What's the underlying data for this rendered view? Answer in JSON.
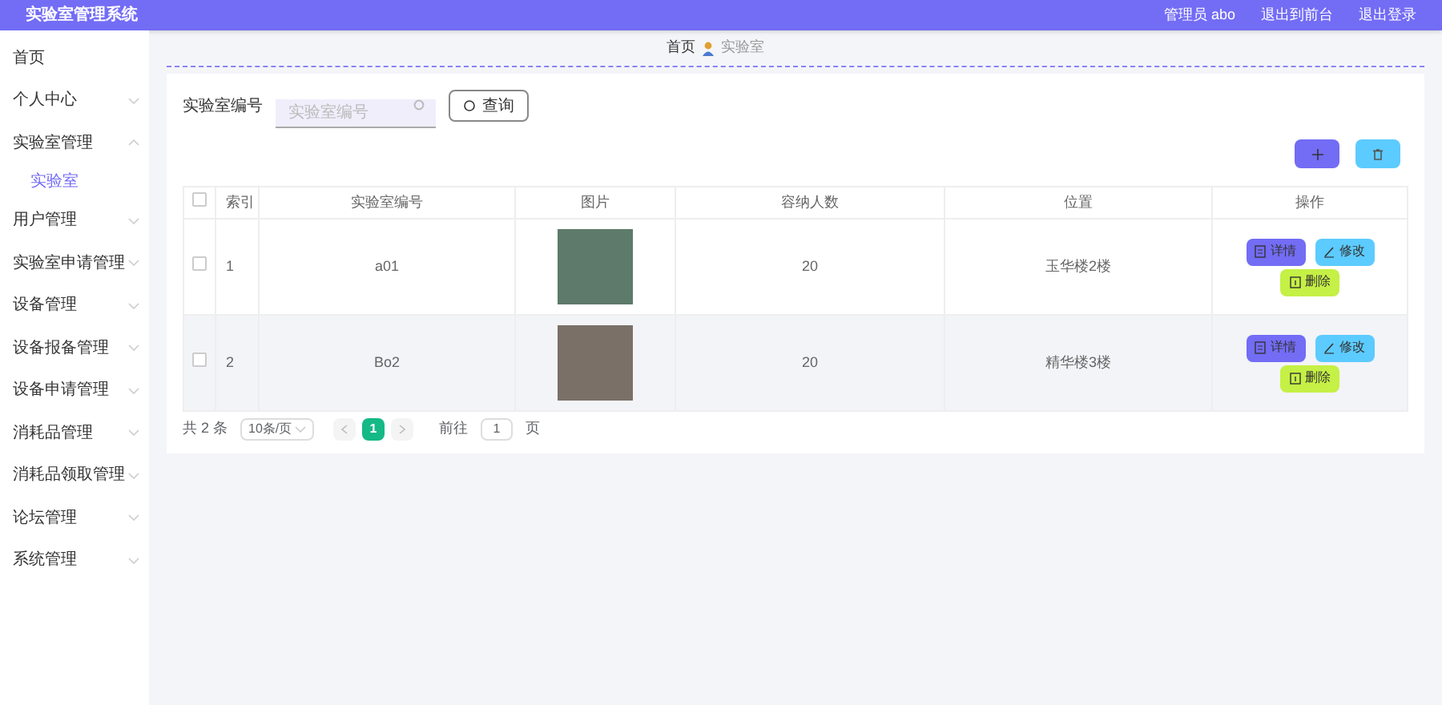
{
  "header": {
    "title": "实验室管理系统",
    "links": [
      "管理员 abo",
      "退出到前台",
      "退出登录"
    ]
  },
  "sidebar": {
    "items": [
      {
        "label": "首页",
        "kind": "link"
      },
      {
        "label": "个人中心",
        "kind": "menu",
        "expanded": false
      },
      {
        "label": "实验室管理",
        "kind": "menu",
        "expanded": true,
        "children": [
          {
            "label": "实验室",
            "selected": true
          }
        ]
      },
      {
        "label": "用户管理",
        "kind": "menu",
        "expanded": false
      },
      {
        "label": "实验室申请管理",
        "kind": "menu",
        "expanded": false
      },
      {
        "label": "设备管理",
        "kind": "menu",
        "expanded": false
      },
      {
        "label": "设备报备管理",
        "kind": "menu",
        "expanded": false
      },
      {
        "label": "设备申请管理",
        "kind": "menu",
        "expanded": false
      },
      {
        "label": "消耗品管理",
        "kind": "menu",
        "expanded": false
      },
      {
        "label": "消耗品领取管理",
        "kind": "menu",
        "expanded": false
      },
      {
        "label": "论坛管理",
        "kind": "menu",
        "expanded": false
      },
      {
        "label": "系统管理",
        "kind": "menu",
        "expanded": false
      }
    ]
  },
  "breadcrumb": [
    "首页",
    "实验室"
  ],
  "search": {
    "label": "实验室编号",
    "placeholder": "实验室编号",
    "button": "查询"
  },
  "table": {
    "select_all_checked": false,
    "columns": [
      "索引",
      "实验室编号",
      "图片",
      "容纳人数",
      "位置",
      "操作"
    ],
    "rows": [
      {
        "checked": false,
        "index": "1",
        "code": "a01",
        "capacity": "20",
        "location": "玉华楼2楼",
        "actions": [
          "详情",
          "修改",
          "删除"
        ]
      },
      {
        "checked": false,
        "index": "2",
        "code": "Bo2",
        "capacity": "20",
        "location": "精华楼3楼",
        "actions": [
          "详情",
          "修改",
          "删除"
        ]
      }
    ]
  },
  "pagination": {
    "total": "共 2 条",
    "page_size": "10条/页",
    "pages": [
      {
        "label": "1",
        "selected": true
      }
    ],
    "goto_label": "前往",
    "goto_value": "1",
    "goto_suffix": "页"
  }
}
